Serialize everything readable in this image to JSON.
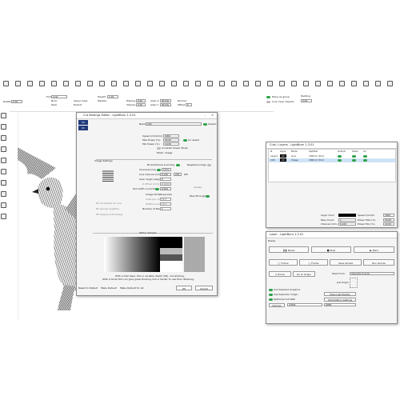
{
  "toolbar": {
    "row2": {
      "rotate_label": "Rotate",
      "rotate_value": "0.00",
      "font_label": "Font",
      "font_value": "Arial",
      "bold": "Bold",
      "italic": "Italic",
      "upper_case": "Upper Case",
      "distort": "Distort",
      "welded": "Welded",
      "height_label": "Height",
      "height_value": "1.00",
      "hspace_label": "HSpace",
      "hspace_value": "0.00",
      "vspace_label": "VSpace",
      "vspace_value": "0.00",
      "align_x_label": "Align X",
      "align_x_value": "Middle",
      "align_y_label": "Align Y",
      "align_y_value": "Middle",
      "normal": "Normal",
      "offset_label": "Offset",
      "offset_value": "0",
      "move_as_group": "Move as group",
      "lock_inner": "Lock inner objects",
      "padding_label": "Padding",
      "padding_value": "0.00"
    }
  },
  "cut_settings": {
    "title": "Cut Settings Editor - LightBurn 1.3.01",
    "tabs": [
      "00",
      "01"
    ],
    "name_label": "Name",
    "name_value": "C00",
    "output_label": "Output",
    "speed_label": "Speed (mm/min)",
    "speed_value": "2000",
    "max_power_label": "Max Power (%)",
    "max_power_value": "50.00",
    "min_power_label": "Min Power (%)",
    "min_power_value": "10.00",
    "air_assist": "Air Assist",
    "constant_power": "Constant Power Mode",
    "mode_label": "Mode",
    "mode_value": "Image",
    "image_settings": "Image Settings",
    "bidir": "Bi-directional scanning",
    "negative": "Negative image",
    "overscanning_label": "Overscanning",
    "overscanning_value": "2.5%",
    "line_interval_label": "Line interval (mm)",
    "line_interval_value": "0.100",
    "dpi_value": "254",
    "dpi_label": "DPI",
    "scan_angle_label": "Scan Angle (deg)",
    "scan_angle_value": "0",
    "z_offset_label": "Z Offset (mm)",
    "z_offset_value": "0.0000",
    "dot_width_label": "Dot width correction",
    "dot_width_value": "0.000",
    "none": "(none)",
    "image_mode_label": "Image Mode",
    "image_mode_value": "Grayscale",
    "pass_through": "Pass-Through",
    "cells_per_inch_label": "Cells per inch",
    "cells_per_inch_value": "56.0",
    "halftone_angle_label": "Halftone angle",
    "halftone_angle_value": "22.5",
    "fill_shapes_at_once": "Fill all shapes at once",
    "fill_groups_together": "Fill groups together",
    "fill_shapes_individually": "Fill shapes individually",
    "number_of_passes_label": "Number of Passes",
    "number_of_passes_value": "1",
    "dither_sample": "Dither Sample",
    "footer_note_1": "With a CO2 laser, this is variable depth (3D), not shading.",
    "footer_note_2": "With a diode this can give great shading, but is harder to use than dithering.",
    "reset_default": "Reset to Default",
    "make_default": "Make Default",
    "make_default_all": "Make Default for all",
    "ok": "OK",
    "cancel": "Cancel"
  },
  "cuts_layers": {
    "title": "Cuts / Layers - LightBurn 1.3.01",
    "headers": [
      "#",
      "Layer",
      "Mode",
      "Spd/Pwr",
      "Output",
      "Show",
      "Air"
    ],
    "rows": [
      {
        "num": "Lasers",
        "layer": "00",
        "mode": "Line",
        "spdpwr": "1500.0 / 50.0"
      },
      {
        "num": "C00",
        "layer": "00",
        "mode": "Image",
        "spdpwr": "2000.0 / 50.0"
      }
    ],
    "layer_color_label": "Layer Color",
    "speed_label": "Speed (mm/m",
    "speed_value": "2000",
    "pass_count_label": "Pass Count",
    "pass_count_value": "1",
    "max_power_label": "Power Max (%)",
    "max_power_value": "50.00",
    "interval_label": "Interval (mm)",
    "interval_value": "0.100",
    "min_power_label": "Power Min (%)",
    "min_power_value": "10.00"
  },
  "laser": {
    "title": "Laser - LightBurn 1.3.01",
    "status": "Ready",
    "pause": "Pause",
    "stop": "Stop",
    "start": "Start",
    "frame1": "Frame",
    "frame2": "Frame",
    "save_gcode": "Save GCode",
    "run_gcode": "Run GCode",
    "home": "Home",
    "go_to_origin": "Go to Origin",
    "start_from_label": "Start From:",
    "start_from_value": "Absolute Coords",
    "job_origin": "Job Origin",
    "cut_selected": "Cut Selected Graphics",
    "use_selection_origin": "Use Selection Origin",
    "show_last_position": "Show Last Position",
    "optimize_cut_path": "Optimize Cut Path",
    "optimization_settings": "Optimization Settings",
    "devices": "Devices",
    "port": "COM4",
    "device": "GRBL"
  },
  "colors": {
    "accent_green": "#2ea34a",
    "selection_blue": "#cfe3f7",
    "panel_bg": "#f4f4f4"
  }
}
